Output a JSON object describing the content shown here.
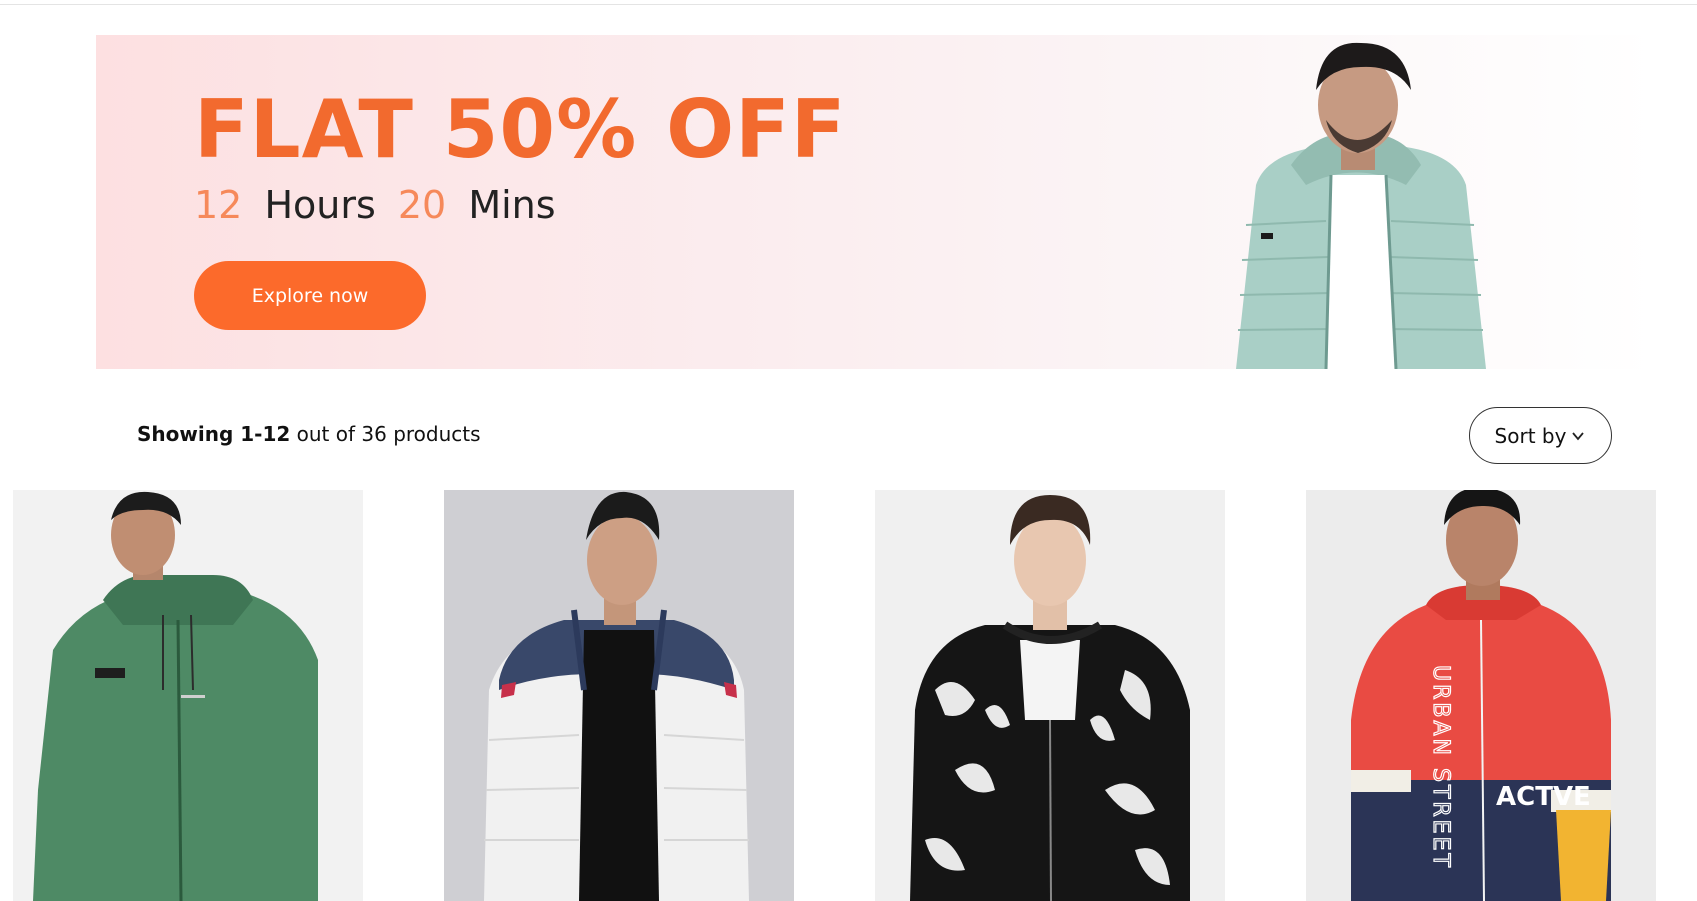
{
  "banner": {
    "headline": "FLAT 50% OFF",
    "timer": {
      "hours_value": "12",
      "hours_unit": "Hours",
      "mins_value": "20",
      "mins_unit": "Mins"
    },
    "cta_label": "Explore now"
  },
  "results": {
    "showing_prefix": "Showing 1-12",
    "showing_suffix": " out of 36 products"
  },
  "sort": {
    "label": "Sort by",
    "icon": "chevron-down-icon"
  },
  "products": [
    {
      "name": "green-zip-hoodie",
      "bg": "#f2f2f2"
    },
    {
      "name": "navy-white-puffer-jacket",
      "bg": "#cfcfd3"
    },
    {
      "name": "black-white-printed-bomber",
      "bg": "#f0f0f0"
    },
    {
      "name": "red-navy-urban-street-jacket",
      "bg": "#ececec",
      "print_text_1": "URBAN STREET",
      "print_text_2": "ACTVE"
    }
  ],
  "colors": {
    "accent": "#fc6a2b",
    "headline": "#f26a2e",
    "timer_number": "#f6895a"
  }
}
